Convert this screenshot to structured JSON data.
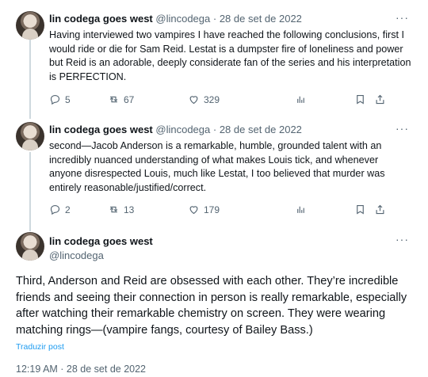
{
  "tweets": [
    {
      "name": "lin codega goes west",
      "handle": "@lincodega",
      "date": "· 28 de set de 2022",
      "text": "Having interviewed two vampires I have reached the following conclusions, first I would ride or die for Sam Reid. Lestat is a dumpster fire of loneliness and power but Reid is an adorable, deeply considerate fan of the series and his interpretation is PERFECTION.",
      "replies": "5",
      "retweets": "67",
      "likes": "329"
    },
    {
      "name": "lin codega goes west",
      "handle": "@lincodega",
      "date": "· 28 de set de 2022",
      "text": "second—Jacob Anderson is a remarkable, humble, grounded talent with an incredibly nuanced understanding of what makes Louis tick, and whenever anyone disrespected Louis, much like Lestat, I too believed that murder was entirely reasonable/justified/correct.",
      "replies": "2",
      "retweets": "13",
      "likes": "179"
    }
  ],
  "main": {
    "name": "lin codega goes west",
    "handle": "@lincodega",
    "text": "Third, Anderson and Reid are obsessed with each other. They’re incredible friends and seeing their connection in person is really remarkable, especially after watching their remarkable chemistry on screen. They were wearing matching rings—(vampire fangs, courtesy of Bailey Bass.)",
    "translate": "Traduzir post",
    "timestamp": "12:19 AM · 28 de set de 2022"
  },
  "more_glyph": "···",
  "icons": [
    "reply-icon",
    "retweet-icon",
    "like-icon",
    "views-icon",
    "bookmark-icon",
    "share-icon",
    "more-icon"
  ]
}
